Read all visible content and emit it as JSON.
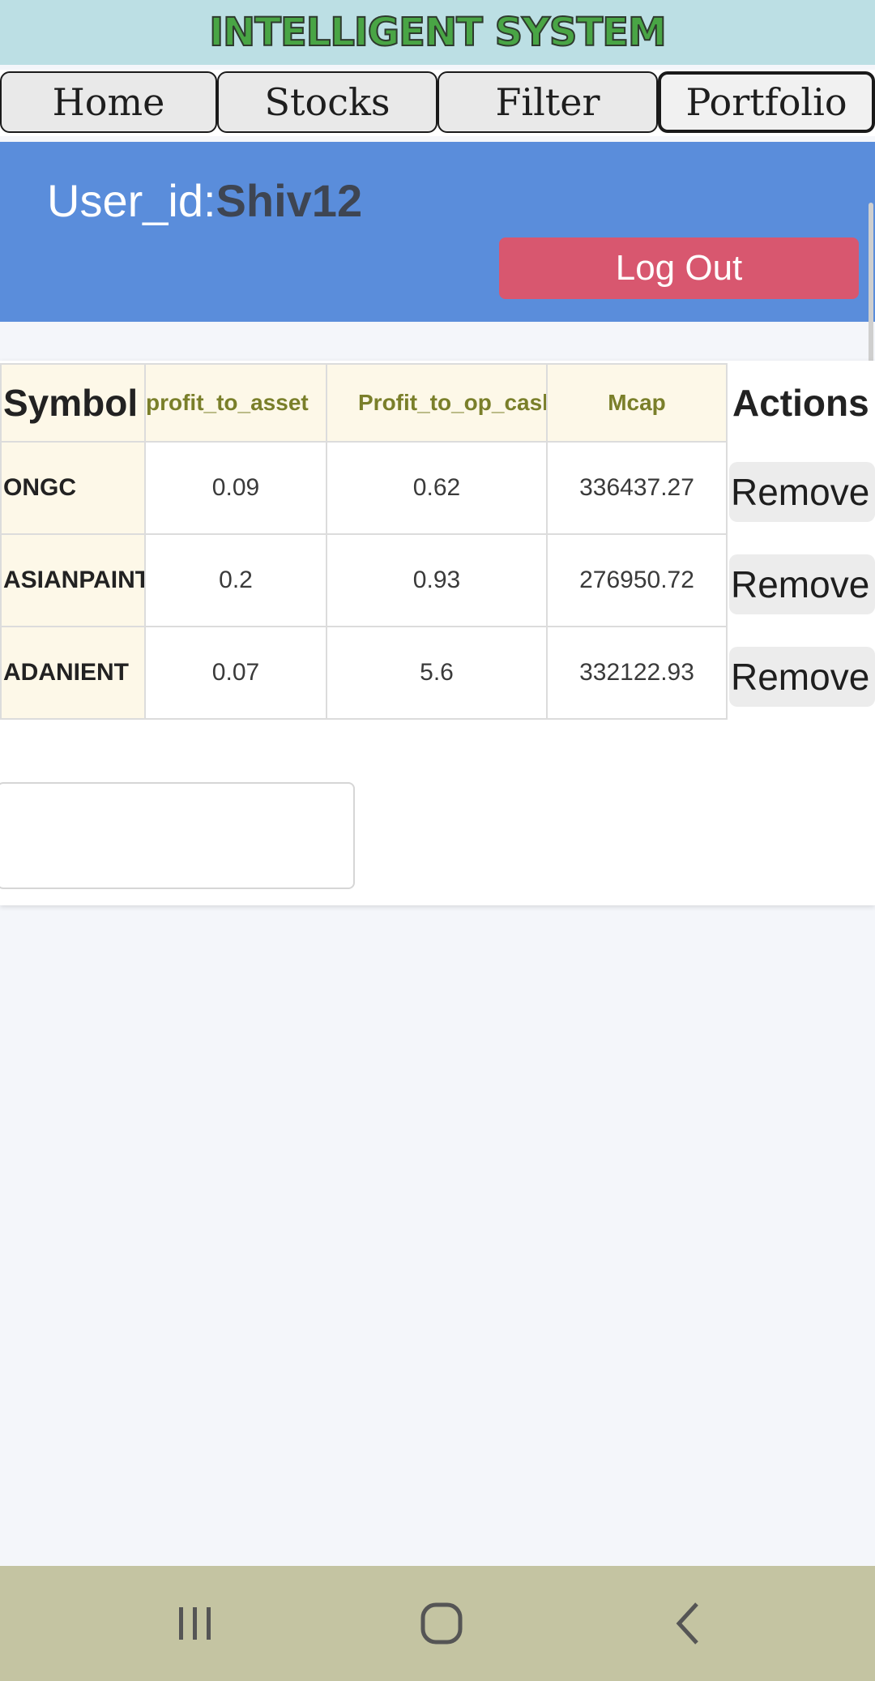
{
  "app": {
    "title": "INTELLIGENT SYSTEM"
  },
  "tabs": [
    {
      "label": "Home"
    },
    {
      "label": "Stocks"
    },
    {
      "label": "Filter"
    },
    {
      "label": "Portfolio",
      "active": true
    }
  ],
  "user": {
    "label": "User_id:",
    "value": "Shiv12",
    "logout_label": "Log Out"
  },
  "table": {
    "columns": [
      "Symbol",
      "profit_to_asset",
      "Profit_to_op_cash",
      "Mcap",
      "Actions"
    ],
    "rows": [
      {
        "symbol": "ONGC",
        "profit_to_asset": "0.09",
        "profit_to_op_cash": "0.62",
        "mcap": "336437.27",
        "action": "Remove"
      },
      {
        "symbol": "ASIANPAINT",
        "profit_to_asset": "0.2",
        "profit_to_op_cash": "0.93",
        "mcap": "276950.72",
        "action": "Remove"
      },
      {
        "symbol": "ADANIENT",
        "profit_to_asset": "0.07",
        "profit_to_op_cash": "5.6",
        "mcap": "332122.93",
        "action": "Remove"
      }
    ]
  },
  "navbar": {
    "icons": [
      "recent-apps-icon",
      "home-circle-icon",
      "back-chevron-icon"
    ]
  },
  "colors": {
    "header_bg": "#bcdfe4",
    "title_green": "#49a545",
    "user_panel_bg": "#5a8ddb",
    "logout_bg": "#d8576f",
    "table_header_bg": "#fdf8e8",
    "navbar_bg": "#c4c4a2"
  }
}
